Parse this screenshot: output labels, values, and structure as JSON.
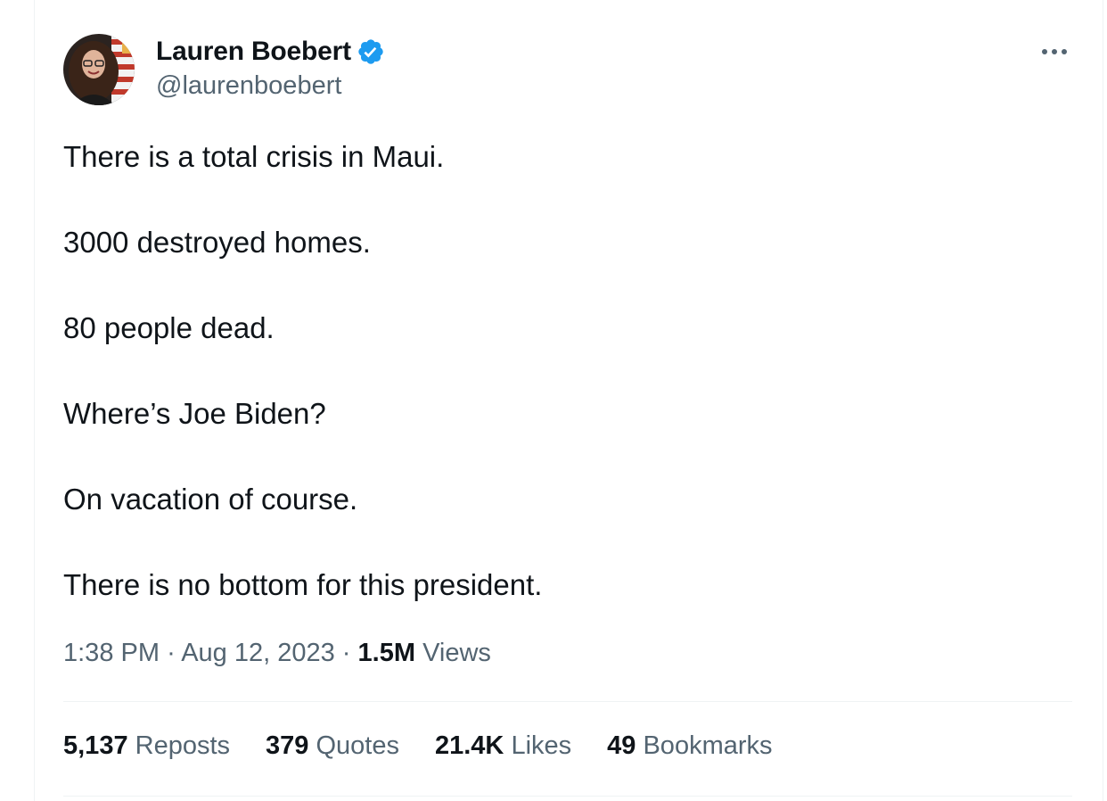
{
  "user": {
    "display_name": "Lauren Boebert",
    "handle": "@laurenboebert",
    "verified_icon": "verified-badge-icon",
    "verified_color": "#1d9bf0"
  },
  "tweet": {
    "paragraphs": [
      "There is a total crisis in Maui.",
      "3000 destroyed homes.",
      "80 people dead.",
      "Where’s Joe Biden?",
      "On vacation of course.",
      "There is no bottom for this president."
    ],
    "time": "1:38 PM",
    "separator": "·",
    "date": "Aug 12, 2023",
    "views_count": "1.5M",
    "views_label": "Views"
  },
  "stats": {
    "reposts_count": "5,137",
    "reposts_label": "Reposts",
    "quotes_count": "379",
    "quotes_label": "Quotes",
    "likes_count": "21.4K",
    "likes_label": "Likes",
    "bookmarks_count": "49",
    "bookmarks_label": "Bookmarks"
  },
  "menu": {
    "icon": "more-horizontal-icon"
  },
  "colors": {
    "text_primary": "#0f1419",
    "text_secondary": "#536471",
    "divider": "#eff3f4"
  }
}
